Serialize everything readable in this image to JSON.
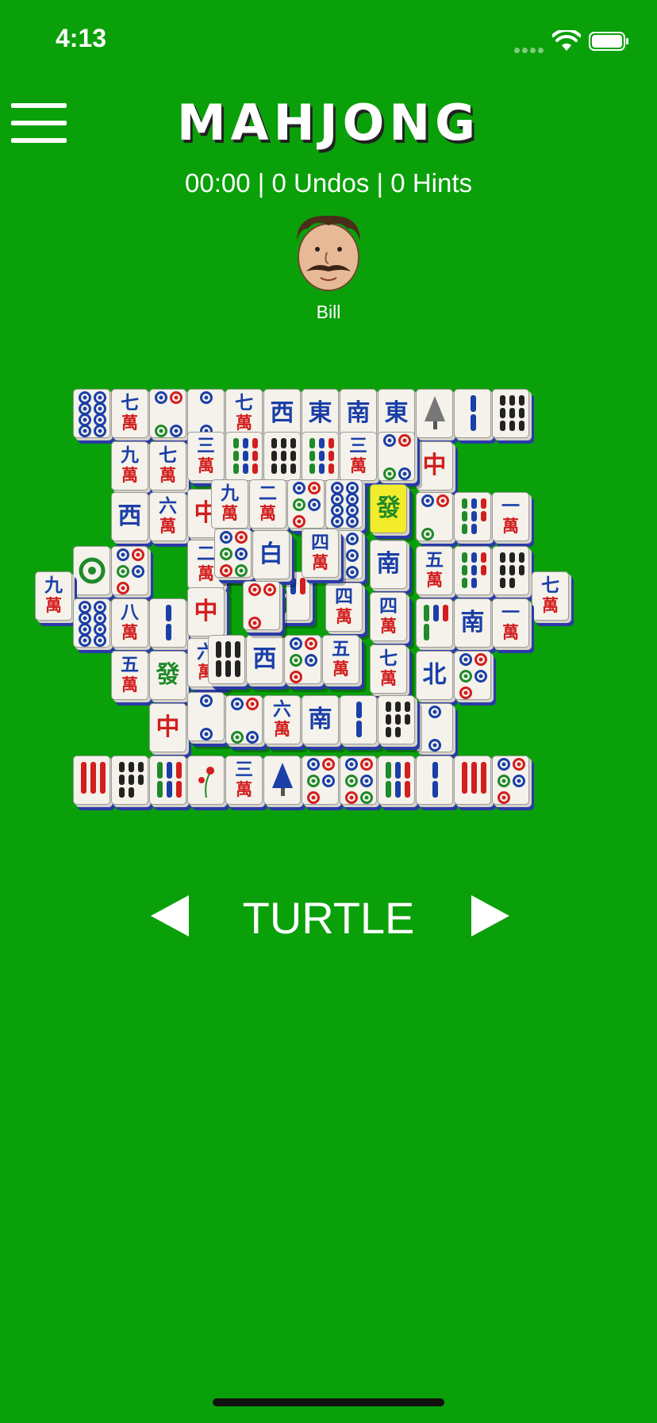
{
  "status_bar": {
    "time": "4:13",
    "icons": [
      "signal-dots-icon",
      "wifi-icon",
      "battery-icon"
    ]
  },
  "header": {
    "menu_icon": "hamburger-menu-icon",
    "title": "MAHJONG",
    "stats": "00:00 | 0 Undos | 0 Hints"
  },
  "player": {
    "name": "Bill",
    "avatar": "mustache-man-avatar"
  },
  "layout_selector": {
    "prev_icon": "left-triangle-icon",
    "label": "TURTLE",
    "next_icon": "right-triangle-icon"
  },
  "colors": {
    "background": "#0aa00a",
    "tile_face": "#f4f2ea",
    "tile_edge": "#2a3aa8",
    "selected_tile": "#f2ec2a",
    "red": "#d21e1e",
    "blue": "#1b3fa8",
    "green": "#1e8a2a"
  },
  "tiles": [
    {
      "kind": "dots",
      "n": 8,
      "col": "blue"
    },
    {
      "kind": "char",
      "top": "七",
      "bottom": "萬"
    },
    {
      "kind": "dots",
      "n": 4,
      "col": "mix"
    },
    {
      "kind": "dots",
      "n": 2,
      "col": "blue"
    },
    {
      "kind": "char",
      "top": "七",
      "bottom": "萬"
    },
    {
      "kind": "wind",
      "text": "西"
    },
    {
      "kind": "wind",
      "text": "東"
    },
    {
      "kind": "wind",
      "text": "南"
    },
    {
      "kind": "wind",
      "text": "東"
    },
    {
      "kind": "season",
      "name": "winter-tree-icon"
    },
    {
      "kind": "bamboo",
      "n": 2,
      "col": "blue"
    },
    {
      "kind": "bamboo",
      "n": 9,
      "col": "dark"
    },
    {
      "kind": "char",
      "top": "三",
      "bottom": "萬"
    },
    {
      "kind": "bamboo",
      "n": 9,
      "col": "mix"
    },
    {
      "kind": "bamboo",
      "n": 9,
      "col": "dark"
    },
    {
      "kind": "bamboo",
      "n": 9,
      "col": "mix"
    },
    {
      "kind": "char",
      "top": "三",
      "bottom": "萬"
    },
    {
      "kind": "dots",
      "n": 4,
      "col": "mix"
    },
    {
      "kind": "dragon",
      "text": "中",
      "col": "red"
    },
    {
      "kind": "char",
      "top": "九",
      "bottom": "萬"
    },
    {
      "kind": "char",
      "top": "二",
      "bottom": "萬"
    },
    {
      "kind": "dots",
      "n": 5,
      "col": "mix"
    },
    {
      "kind": "dots",
      "n": 8,
      "col": "blue"
    },
    {
      "kind": "dragon",
      "text": "發",
      "col": "green"
    },
    {
      "kind": "wind",
      "text": "西"
    },
    {
      "kind": "char",
      "top": "六",
      "bottom": "萬"
    },
    {
      "kind": "dragon",
      "text": "中",
      "col": "red"
    },
    {
      "kind": "dots",
      "n": 3,
      "col": "mix"
    },
    {
      "kind": "bamboo",
      "n": 8,
      "col": "mix"
    },
    {
      "kind": "char",
      "top": "九",
      "bottom": "萬"
    },
    {
      "kind": "dots",
      "n": 1,
      "col": "green"
    },
    {
      "kind": "dots",
      "n": 5,
      "col": "mix"
    },
    {
      "kind": "char",
      "top": "二",
      "bottom": "萬"
    },
    {
      "kind": "wind",
      "text": "東"
    },
    {
      "kind": "dots",
      "n": 6,
      "col": "blue"
    },
    {
      "kind": "wind",
      "text": "南"
    },
    {
      "kind": "char",
      "top": "五",
      "bottom": "萬"
    },
    {
      "kind": "bamboo",
      "n": 8,
      "col": "mix"
    },
    {
      "kind": "bamboo",
      "n": 8,
      "col": "dark"
    },
    {
      "kind": "char",
      "top": "七",
      "bottom": "萬"
    },
    {
      "kind": "char",
      "top": "四",
      "bottom": "萬"
    },
    {
      "kind": "dots",
      "n": 8,
      "col": "blue"
    },
    {
      "kind": "char",
      "top": "八",
      "bottom": "萬"
    },
    {
      "kind": "bamboo",
      "n": 2,
      "col": "blue"
    },
    {
      "kind": "dragon",
      "text": "中",
      "col": "red"
    },
    {
      "kind": "bamboo",
      "n": 4,
      "col": "mix"
    },
    {
      "kind": "char",
      "top": "四",
      "bottom": "萬"
    },
    {
      "kind": "bamboo",
      "n": 4,
      "col": "mix"
    },
    {
      "kind": "wind",
      "text": "南"
    },
    {
      "kind": "char",
      "top": "一",
      "bottom": "萬"
    },
    {
      "kind": "char",
      "top": "五",
      "bottom": "萬"
    },
    {
      "kind": "dragon",
      "text": "發",
      "col": "green"
    },
    {
      "kind": "char",
      "top": "六",
      "bottom": "萬"
    },
    {
      "kind": "bamboo",
      "n": 6,
      "col": "dark"
    },
    {
      "kind": "wind",
      "text": "西"
    },
    {
      "kind": "dots",
      "n": 5,
      "col": "mix"
    },
    {
      "kind": "char",
      "top": "五",
      "bottom": "萬"
    },
    {
      "kind": "char",
      "top": "七",
      "bottom": "萬"
    },
    {
      "kind": "wind",
      "text": "北"
    },
    {
      "kind": "dots",
      "n": 5,
      "col": "mix"
    },
    {
      "kind": "dragon",
      "text": "中",
      "col": "red"
    },
    {
      "kind": "dots",
      "n": 2,
      "col": "blue"
    },
    {
      "kind": "dots",
      "n": 4,
      "col": "mix"
    },
    {
      "kind": "char",
      "top": "六",
      "bottom": "萬"
    },
    {
      "kind": "wind",
      "text": "南"
    },
    {
      "kind": "bamboo",
      "n": 2,
      "col": "blue"
    },
    {
      "kind": "bamboo",
      "n": 8,
      "col": "dark"
    },
    {
      "kind": "dots",
      "n": 2,
      "col": "blue"
    },
    {
      "kind": "bamboo",
      "n": 3,
      "col": "red"
    },
    {
      "kind": "bamboo",
      "n": 8,
      "col": "dark"
    },
    {
      "kind": "bamboo",
      "n": 6,
      "col": "mix"
    },
    {
      "kind": "flower",
      "name": "flower-icon"
    },
    {
      "kind": "char",
      "top": "三",
      "bottom": "萬"
    },
    {
      "kind": "season",
      "name": "pine-tree-icon"
    },
    {
      "kind": "dots",
      "n": 5,
      "col": "mix"
    },
    {
      "kind": "dots",
      "n": 6,
      "col": "mix"
    },
    {
      "kind": "bamboo",
      "n": 6,
      "col": "mix"
    },
    {
      "kind": "bamboo",
      "n": 2,
      "col": "blue"
    },
    {
      "kind": "bamboo",
      "n": 3,
      "col": "red"
    },
    {
      "kind": "dots",
      "n": 5,
      "col": "mix"
    },
    {
      "kind": "char",
      "top": "一",
      "bottom": "萬"
    },
    {
      "kind": "char",
      "top": "九",
      "bottom": "萬"
    },
    {
      "kind": "char",
      "top": "七",
      "bottom": "萬"
    },
    {
      "kind": "char",
      "top": "四",
      "bottom": "萬"
    },
    {
      "kind": "dots",
      "n": 6,
      "col": "mix"
    },
    {
      "kind": "dragon",
      "text": "白",
      "col": "blue"
    },
    {
      "kind": "dots",
      "n": 3,
      "col": "red"
    },
    {
      "kind": "bamboo",
      "n": 3,
      "col": "red"
    }
  ]
}
